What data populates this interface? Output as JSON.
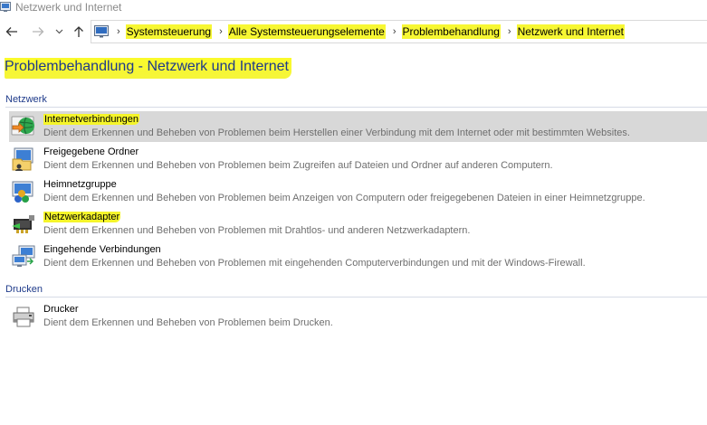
{
  "window": {
    "title": "Netzwerk und Internet",
    "icon": "control-panel-icon"
  },
  "nav": {
    "back_icon": "back-arrow-icon",
    "forward_icon": "forward-arrow-icon",
    "recent_icon": "chevron-down-icon",
    "up_icon": "up-arrow-icon"
  },
  "breadcrumbs": [
    "Systemsteuerung",
    "Alle Systemsteuerungselemente",
    "Problembehandlung",
    "Netzwerk und Internet"
  ],
  "page_title": "Problembehandlung - Netzwerk und Internet",
  "sections": [
    {
      "label": "Netzwerk",
      "items": [
        {
          "name": "Internetverbindungen",
          "desc": "Dient dem Erkennen und Beheben von Problemen beim Herstellen einer Verbindung mit dem Internet oder mit bestimmten Websites.",
          "icon": "globe-network-icon"
        },
        {
          "name": "Freigegebene Ordner",
          "desc": "Dient dem Erkennen und Beheben von Problemen beim Zugreifen auf Dateien und Ordner auf anderen Computern.",
          "icon": "shared-folder-icon"
        },
        {
          "name": "Heimnetzgruppe",
          "desc": "Dient dem Erkennen und Beheben von Problemen beim Anzeigen von Computern oder freigegebenen Dateien in einer Heimnetzgruppe.",
          "icon": "homegroup-icon"
        },
        {
          "name": "Netzwerkadapter",
          "desc": "Dient dem Erkennen und Beheben von Problemen mit Drahtlos- und anderen Netzwerkadaptern.",
          "icon": "network-adapter-icon"
        },
        {
          "name": "Eingehende Verbindungen",
          "desc": "Dient dem Erkennen und Beheben von Problemen mit eingehenden Computerverbindungen und mit der Windows-Firewall.",
          "icon": "incoming-connections-icon"
        }
      ]
    },
    {
      "label": "Drucken",
      "items": [
        {
          "name": "Drucker",
          "desc": "Dient dem Erkennen und Beheben von Problemen beim Drucken.",
          "icon": "printer-icon"
        }
      ]
    }
  ],
  "colors": {
    "accent": "#1e3a8a",
    "highlight": "#f5f52a",
    "selected_row": "#d8d8d8"
  }
}
